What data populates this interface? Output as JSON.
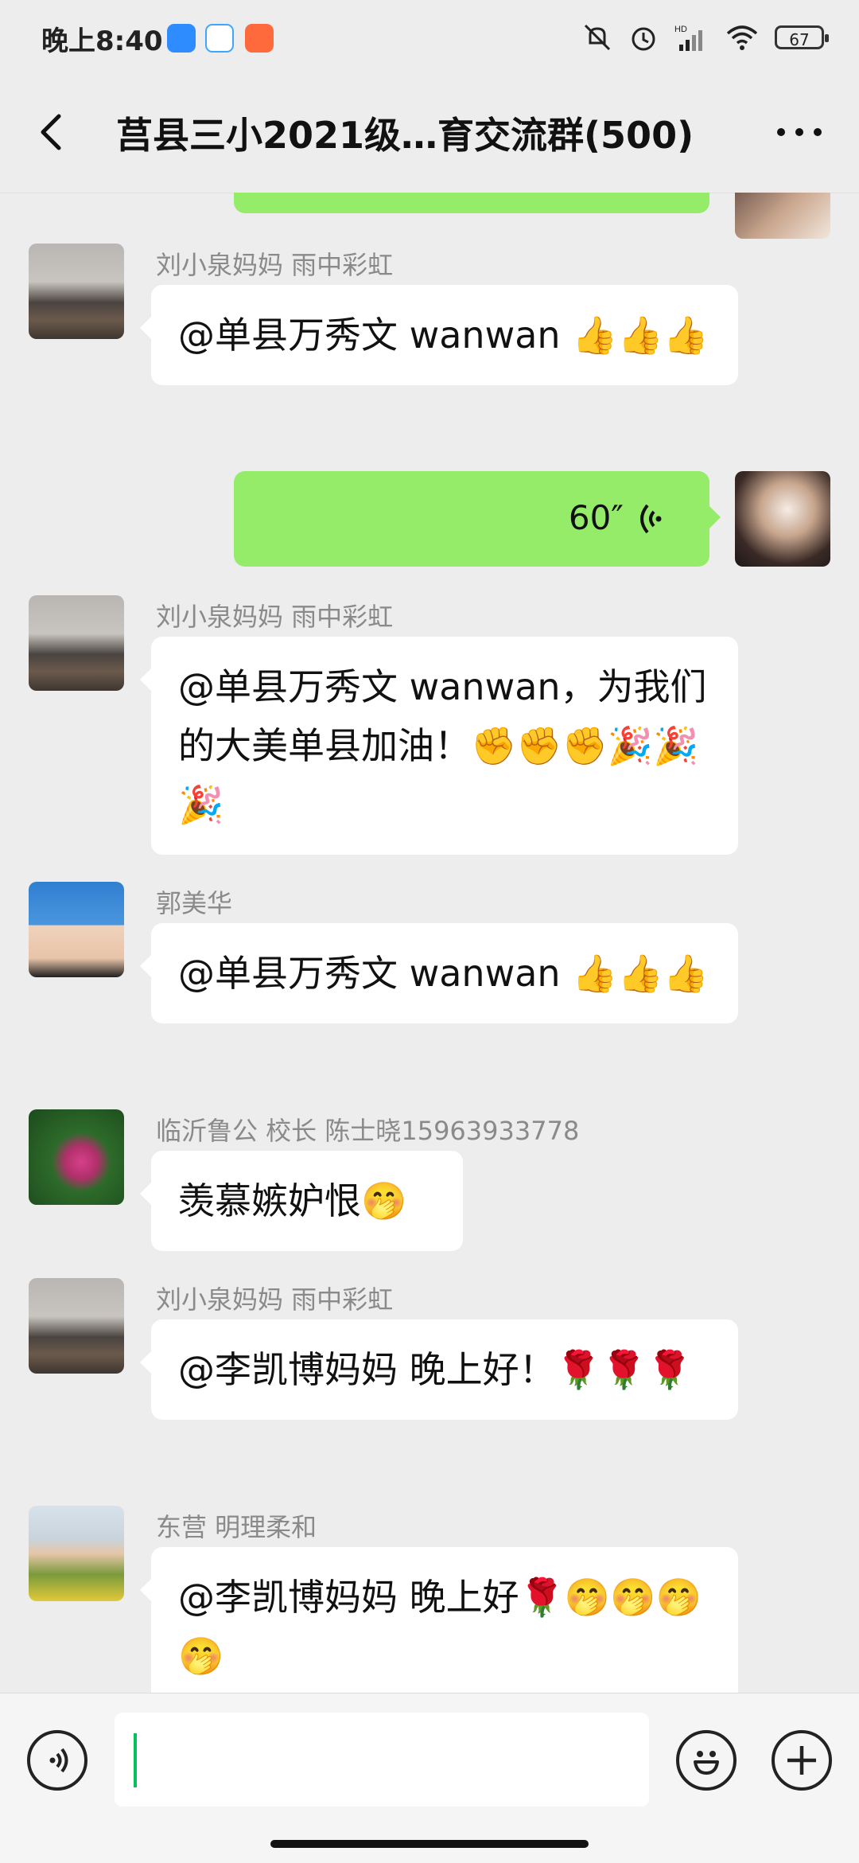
{
  "status": {
    "time": "晚上8:40",
    "battery": "67",
    "icons": [
      "mute-icon",
      "alarm-icon",
      "hd-signal-icon",
      "wifi-icon",
      "battery-icon"
    ]
  },
  "header": {
    "title": "莒县三小2021级…育交流群(500)",
    "back_icon": "chevron-left-icon",
    "more_icon": "more-dots-icon"
  },
  "messages": [
    {
      "sender": "刘小泉妈妈  雨中彩虹",
      "text": "@单县万秀文  wanwan 👍👍👍"
    },
    {
      "type": "voice",
      "duration": "60″"
    },
    {
      "sender": "刘小泉妈妈  雨中彩虹",
      "text": "@单县万秀文  wanwan，为我们的大美单县加油！✊✊✊🎉🎉🎉"
    },
    {
      "sender": "郭美华",
      "text": "@单县万秀文  wanwan 👍👍👍"
    },
    {
      "sender": "临沂鲁公 校长  陈士晓15963933778",
      "text": "羡慕嫉妒恨🤭"
    },
    {
      "sender": "刘小泉妈妈  雨中彩虹",
      "text": "@李凯博妈妈  晚上好！🌹🌹🌹"
    },
    {
      "sender": "东营  明理柔和",
      "text": "@李凯博妈妈  晚上好🌹🤭🤭🤭🤭"
    }
  ],
  "input": {
    "voice_icon": "voice-mode-icon",
    "emoji_icon": "emoji-icon",
    "plus_icon": "plus-icon"
  },
  "colors": {
    "background": "#ededed",
    "self_bubble": "#95ec69",
    "other_bubble": "#ffffff",
    "cursor": "#07c160"
  }
}
